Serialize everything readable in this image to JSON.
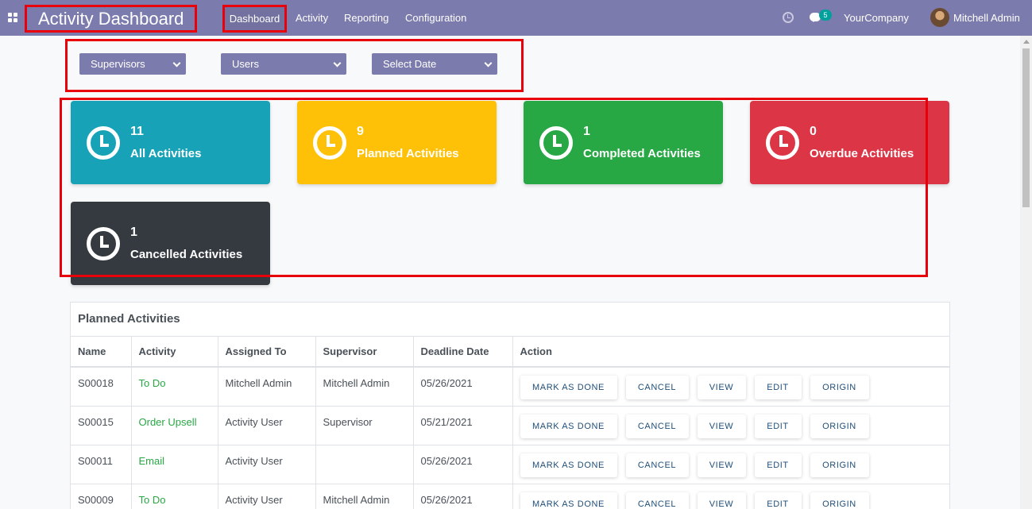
{
  "navbar": {
    "app_title": "Activity Dashboard",
    "menu": [
      "Dashboard",
      "Activity",
      "Reporting",
      "Configuration"
    ],
    "chat_count": "5",
    "company": "YourCompany",
    "user": "Mitchell Admin",
    "bg_color": "#7c7bad"
  },
  "filters": {
    "supervisors": "Supervisors",
    "users": "Users",
    "date": "Select Date"
  },
  "cards": [
    {
      "count": "11",
      "label": "All Activities",
      "color": "#17a2b8",
      "icon": "clock-icon"
    },
    {
      "count": "9",
      "label": "Planned Activities",
      "color": "#ffc107",
      "icon": "clock-icon"
    },
    {
      "count": "1",
      "label": "Completed Activities",
      "color": "#28a745",
      "icon": "clock-icon"
    },
    {
      "count": "0",
      "label": "Overdue Activities",
      "color": "#dc3545",
      "icon": "clock-icon"
    },
    {
      "count": "1",
      "label": "Cancelled Activities",
      "color": "#343a40",
      "icon": "clock-icon"
    }
  ],
  "planned": {
    "title": "Planned Activities",
    "columns": [
      "Name",
      "Activity",
      "Assigned To",
      "Supervisor",
      "Deadline Date",
      "Action"
    ],
    "actions": [
      "MARK AS DONE",
      "CANCEL",
      "VIEW",
      "EDIT",
      "ORIGIN"
    ],
    "rows": [
      {
        "name": "S00018",
        "activity": "To Do",
        "assigned": "Mitchell Admin",
        "supervisor": "Mitchell Admin",
        "deadline": "05/26/2021"
      },
      {
        "name": "S00015",
        "activity": "Order Upsell",
        "assigned": "Activity User",
        "supervisor": "Supervisor",
        "deadline": "05/21/2021"
      },
      {
        "name": "S00011",
        "activity": "Email",
        "assigned": "Activity User",
        "supervisor": "",
        "deadline": "05/26/2021"
      },
      {
        "name": "S00009",
        "activity": "To Do",
        "assigned": "Activity User",
        "supervisor": "Mitchell Admin",
        "deadline": "05/26/2021"
      }
    ]
  }
}
